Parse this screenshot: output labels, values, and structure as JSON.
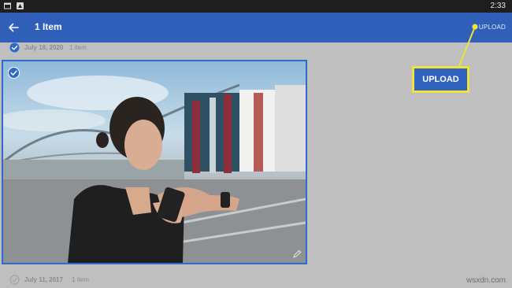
{
  "status_bar": {
    "time": "2:33",
    "icons": [
      "window-icon",
      "notification-icon"
    ]
  },
  "app_bar": {
    "title": "1 Item",
    "back_icon": "arrow-left-icon",
    "upload_label": "UPLOAD"
  },
  "sections": [
    {
      "date": "July 18, 2020",
      "count": "1 item",
      "selected": true
    },
    {
      "date": "July 11, 2017",
      "count": "1 item",
      "selected": false
    }
  ],
  "photo": {
    "selected": true,
    "icons": [
      "check-circle-icon",
      "edit-pencil-icon"
    ]
  },
  "callout": {
    "label": "UPLOAD",
    "highlight_color": "#f0e23a"
  },
  "watermark": "wsxdn.com",
  "colors": {
    "accent": "#2f5fb8",
    "selection": "#2f69c9",
    "background": "#bfbfbf"
  }
}
